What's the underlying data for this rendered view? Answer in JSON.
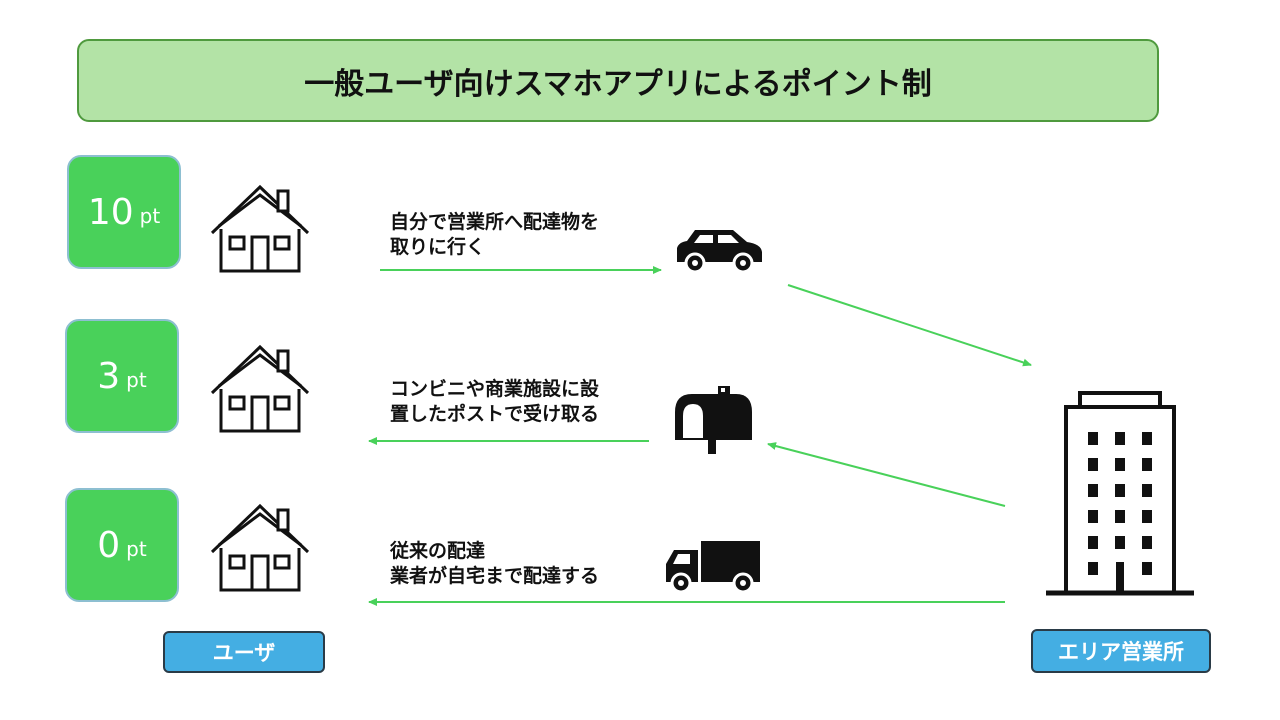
{
  "title": "一般ユーザ向けスマホアプリによるポイント制",
  "rows": [
    {
      "points": "10",
      "unit": "pt",
      "description_line1": "自分で営業所へ配達物を",
      "description_line2": "取りに行く",
      "vehicle_icon": "car-icon"
    },
    {
      "points": "3",
      "unit": "pt",
      "description_line1": "コンビニや商業施設に設",
      "description_line2": "置したポストで受け取る",
      "vehicle_icon": "mailbox-icon"
    },
    {
      "points": "0",
      "unit": "pt",
      "description_line1": "従来の配達",
      "description_line2": "業者が自宅まで配達する",
      "vehicle_icon": "truck-icon"
    }
  ],
  "labels": {
    "user": "ユーザ",
    "office": "エリア営業所"
  },
  "colors": {
    "title_bg": "#b3e3a6",
    "title_border": "#4f9a3e",
    "points_bg": "#49d15a",
    "label_bg": "#44aee3",
    "arrow": "#49d15a"
  },
  "icons": [
    "house-icon",
    "car-icon",
    "mailbox-icon",
    "truck-icon",
    "building-icon"
  ]
}
